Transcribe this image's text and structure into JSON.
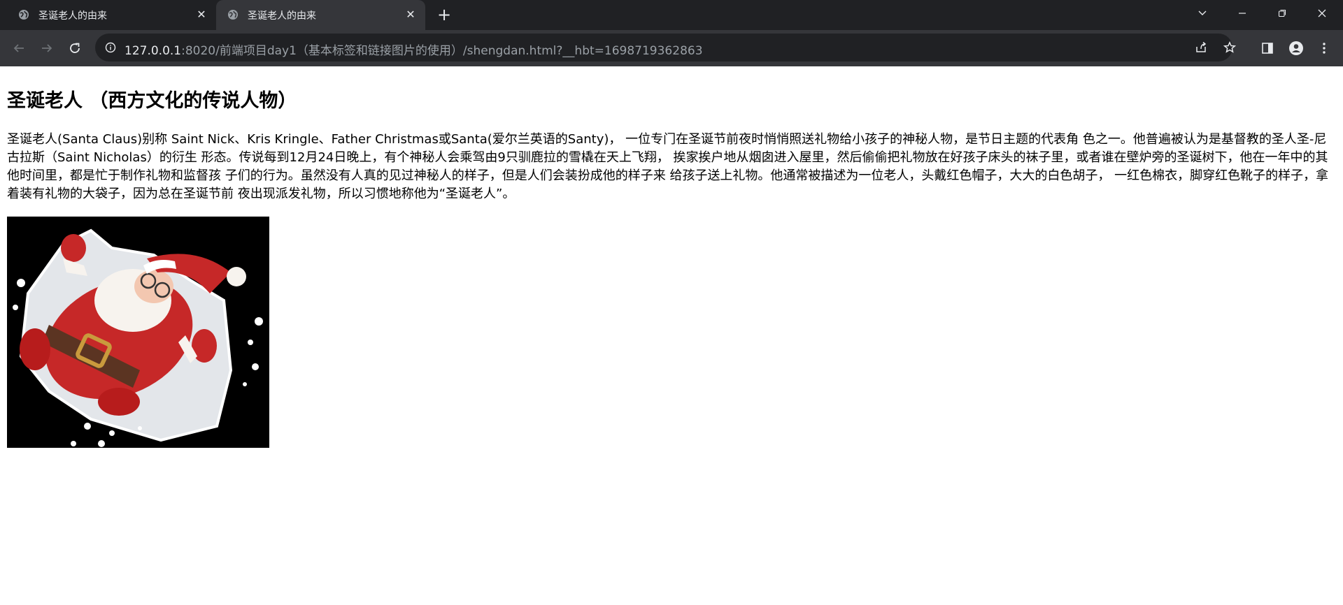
{
  "browser": {
    "tabs": [
      {
        "title": "圣诞老人的由来",
        "active": false
      },
      {
        "title": "圣诞老人的由来",
        "active": true
      }
    ],
    "new_tab_icon": "plus-icon",
    "window_controls": [
      "chevron-down-icon",
      "minimize-icon",
      "restore-icon",
      "close-icon"
    ],
    "address": {
      "host": "127.0.0.1",
      "path": ":8020/前端项目day1（基本标签和链接图片的使用）/shengdan.html?__hbt=1698719362863"
    },
    "colors": {
      "tabbar": "#202124",
      "toolbar": "#35363a",
      "omnibox": "#202124"
    }
  },
  "page": {
    "heading": "圣诞老人 （西方文化的传说人物）",
    "paragraph": "圣诞老人(Santa Claus)别称 Saint Nick、Kris Kringle、Father Christmas或Santa(爱尔兰英语的Santy)， 一位专门在圣诞节前夜时悄悄照送礼物给小孩子的神秘人物，是节日主题的代表角 色之一。他普遍被认为是基督教的圣人圣-尼古拉斯（Saint Nicholas）的衍生 形态。传说每到12月24日晚上，有个神秘人会乘驾由9只驯鹿拉的雪橇在天上飞翔， 挨家挨户地从烟囱进入屋里，然后偷偷把礼物放在好孩子床头的袜子里，或者谁在壁炉旁的圣诞树下，他在一年中的其他时间里，都是忙于制作礼物和监督孩 子们的行为。虽然没有人真的见过神秘人的样子，但是人们会装扮成他的样子来 给孩子送上礼物。他通常被描述为一位老人，头戴红色帽子，大大的白色胡子， 一红色棉衣，脚穿红色靴子的样子，拿着装有礼物的大袋子，因为总在圣诞节前 夜出现派发礼物，所以习惯地称他为“圣诞老人”。",
    "image_icon": "santa-claus-illustration"
  }
}
